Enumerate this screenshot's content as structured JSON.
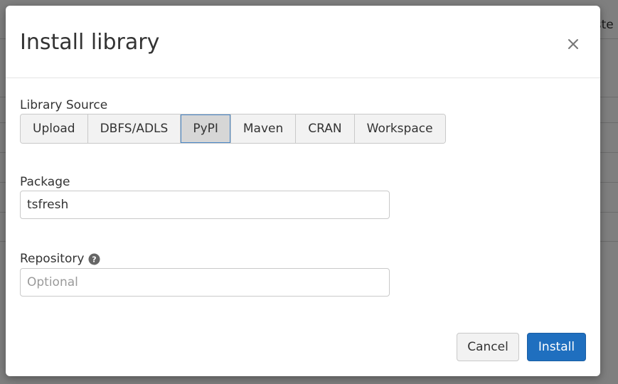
{
  "background": {
    "fragments": [
      "uste"
    ]
  },
  "modal": {
    "title": "Install library",
    "close_icon": "close-icon",
    "library_source": {
      "label": "Library Source",
      "options": [
        "Upload",
        "DBFS/ADLS",
        "PyPI",
        "Maven",
        "CRAN",
        "Workspace"
      ],
      "selected": "PyPI"
    },
    "package": {
      "label": "Package",
      "value": "tsfresh",
      "placeholder": ""
    },
    "repository": {
      "label": "Repository",
      "help_icon": "question-circle-icon",
      "value": "",
      "placeholder": "Optional"
    },
    "footer": {
      "cancel_label": "Cancel",
      "install_label": "Install"
    }
  },
  "colors": {
    "primary": "#1f6fbf",
    "active_border": "#4a88c7"
  }
}
